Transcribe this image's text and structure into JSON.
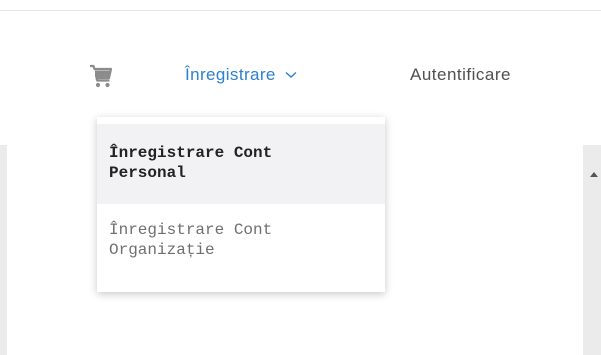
{
  "header": {
    "cart_icon": "shopping-cart-icon",
    "register_label": "Înregistrare",
    "register_chevron": "chevron-down-icon",
    "login_label": "Autentificare"
  },
  "dropdown": {
    "items": [
      {
        "line1": "Înregistrare Cont",
        "line2": "Personal"
      },
      {
        "line1": "Înregistrare Cont",
        "line2": "Organizație"
      }
    ]
  },
  "colors": {
    "accent": "#2e7fcf",
    "text_dark": "#222222",
    "text_muted": "#6f6f6f",
    "hover_bg": "#f2f2f4",
    "page_bg": "#ebebeb"
  }
}
